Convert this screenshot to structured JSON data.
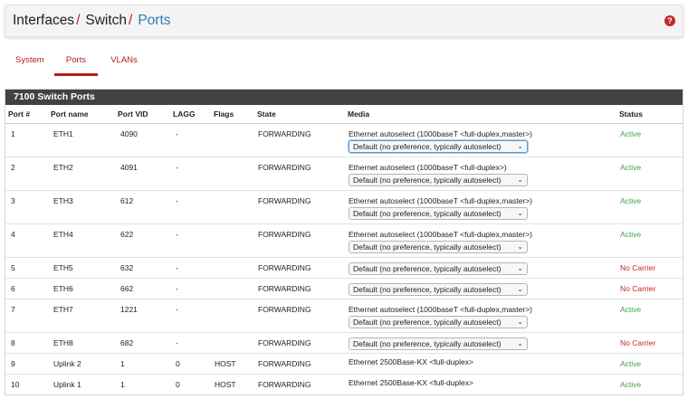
{
  "breadcrumb": {
    "level1": "Interfaces",
    "level2": "Switch",
    "current": "Ports",
    "separator": "/"
  },
  "help_icon": "?",
  "tabs": [
    {
      "label": "System",
      "active": false
    },
    {
      "label": "Ports",
      "active": true
    },
    {
      "label": "VLANs",
      "active": false
    }
  ],
  "panel": {
    "title": "7100 Switch Ports"
  },
  "columns": [
    "Port #",
    "Port name",
    "Port VID",
    "LAGG",
    "Flags",
    "State",
    "Media",
    "Status"
  ],
  "rows": [
    {
      "port": "1",
      "name": "ETH1",
      "vid": "4090",
      "lagg": "-",
      "flags": "",
      "state": "FORWARDING",
      "media": "Ethernet autoselect (1000baseT <full-duplex,master>)",
      "select": "Default (no preference, typically autoselect)",
      "status": "Active",
      "status_ok": true,
      "focused": true
    },
    {
      "port": "2",
      "name": "ETH2",
      "vid": "4091",
      "lagg": "-",
      "flags": "",
      "state": "FORWARDING",
      "media": "Ethernet autoselect (1000baseT <full-duplex>)",
      "select": "Default (no preference, typically autoselect)",
      "status": "Active",
      "status_ok": true
    },
    {
      "port": "3",
      "name": "ETH3",
      "vid": "612",
      "lagg": "-",
      "flags": "",
      "state": "FORWARDING",
      "media": "Ethernet autoselect (1000baseT <full-duplex,master>)",
      "select": "Default (no preference, typically autoselect)",
      "status": "Active",
      "status_ok": true
    },
    {
      "port": "4",
      "name": "ETH4",
      "vid": "622",
      "lagg": "-",
      "flags": "",
      "state": "FORWARDING",
      "media": "Ethernet autoselect (1000baseT <full-duplex,master>)",
      "select": "Default (no preference, typically autoselect)",
      "status": "Active",
      "status_ok": true
    },
    {
      "port": "5",
      "name": "ETH5",
      "vid": "632",
      "lagg": "-",
      "flags": "",
      "state": "FORWARDING",
      "media": "",
      "select": "Default (no preference, typically autoselect)",
      "status": "No Carrier",
      "status_ok": false
    },
    {
      "port": "6",
      "name": "ETH6",
      "vid": "662",
      "lagg": "-",
      "flags": "",
      "state": "FORWARDING",
      "media": "",
      "select": "Default (no preference, typically autoselect)",
      "status": "No Carrier",
      "status_ok": false
    },
    {
      "port": "7",
      "name": "ETH7",
      "vid": "1221",
      "lagg": "-",
      "flags": "",
      "state": "FORWARDING",
      "media": "Ethernet autoselect (1000baseT <full-duplex,master>)",
      "select": "Default (no preference, typically autoselect)",
      "status": "Active",
      "status_ok": true
    },
    {
      "port": "8",
      "name": "ETH8",
      "vid": "682",
      "lagg": "-",
      "flags": "",
      "state": "FORWARDING",
      "media": "",
      "select": "Default (no preference, typically autoselect)",
      "status": "No Carrier",
      "status_ok": false
    },
    {
      "port": "9",
      "name": "Uplink 2",
      "vid": "1",
      "lagg": "0",
      "flags": "HOST",
      "state": "FORWARDING",
      "media": "Ethernet 2500Base-KX <full-duplex>",
      "select": "",
      "status": "Active",
      "status_ok": true
    },
    {
      "port": "10",
      "name": "Uplink 1",
      "vid": "1",
      "lagg": "0",
      "flags": "HOST",
      "state": "FORWARDING",
      "media": "Ethernet 2500Base-KX <full-duplex>",
      "select": "",
      "status": "Active",
      "status_ok": true
    }
  ],
  "colors": {
    "accent": "#b71c1c",
    "link": "#2f7cba",
    "active": "#43a047",
    "no_carrier": "#c62828",
    "panel_heading": "#424242"
  },
  "icons": {
    "select_chevron": "chevron-down-icon",
    "help": "help-icon"
  }
}
